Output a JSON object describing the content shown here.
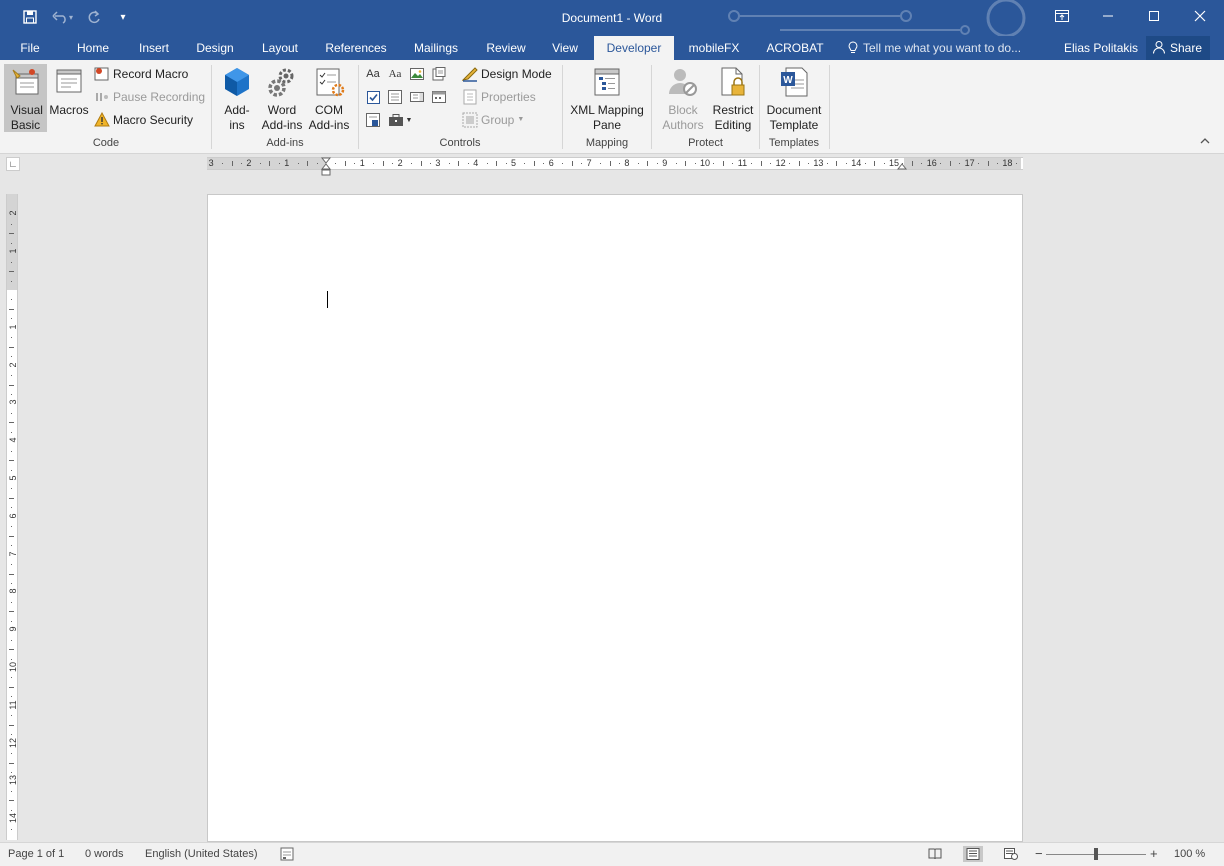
{
  "titlebar": {
    "title": "Document1 - Word",
    "qat": {
      "save": "save-icon",
      "undo": "undo-icon",
      "redo": "redo-icon",
      "customize": "▾"
    },
    "window_controls": {
      "restore_ribbon": "ribbon-display-icon",
      "minimize": "—",
      "maximize": "☐",
      "close": "✕"
    }
  },
  "tabs": [
    {
      "label": "File"
    },
    {
      "label": "Home"
    },
    {
      "label": "Insert"
    },
    {
      "label": "Design"
    },
    {
      "label": "Layout"
    },
    {
      "label": "References"
    },
    {
      "label": "Mailings"
    },
    {
      "label": "Review"
    },
    {
      "label": "View"
    },
    {
      "label": "Developer",
      "active": true
    },
    {
      "label": "mobileFX"
    },
    {
      "label": "ACROBAT"
    }
  ],
  "tellme": {
    "placeholder": "Tell me what you want to do..."
  },
  "user": {
    "name": "Elias Politakis",
    "share": "Share"
  },
  "ribbon": {
    "code": {
      "label": "Code",
      "visual_basic": "Visual Basic",
      "macros": "Macros",
      "record_macro": "Record Macro",
      "pause_recording": "Pause Recording",
      "macro_security": "Macro Security"
    },
    "addins": {
      "label": "Add-ins",
      "addins": "Add-ins",
      "word_addins": "Word Add-ins",
      "com_addins": "COM Add-ins"
    },
    "controls": {
      "label": "Controls",
      "design_mode": "Design Mode",
      "properties": "Properties",
      "group": "Group",
      "aa1": "Aa",
      "aa2": "Aa"
    },
    "mapping": {
      "label": "Mapping",
      "xml_mapping_pane": "XML Mapping Pane"
    },
    "protect": {
      "label": "Protect",
      "block_authors": "Block Authors",
      "restrict_editing": "Restrict Editing"
    },
    "templates": {
      "label": "Templates",
      "document_template": "Document Template"
    }
  },
  "hruler": {
    "numbers": [
      "3",
      "2",
      "1",
      "1",
      "2",
      "3",
      "4",
      "5",
      "6",
      "7",
      "8",
      "9",
      "10",
      "11",
      "12",
      "13",
      "14",
      "15",
      "16",
      "17",
      "18"
    ]
  },
  "vruler": {
    "numbers": [
      "2",
      "1",
      "1",
      "2",
      "3",
      "4",
      "5",
      "6",
      "7",
      "8",
      "9",
      "10",
      "11",
      "12",
      "13",
      "14"
    ]
  },
  "statusbar": {
    "page": "Page 1 of 1",
    "words": "0 words",
    "language": "English (United States)",
    "zoom_minus": "−",
    "zoom_plus": "+",
    "zoom": "100 %"
  },
  "colors": {
    "accent": "#2b579a",
    "ribbon": "#f3f3f3"
  }
}
